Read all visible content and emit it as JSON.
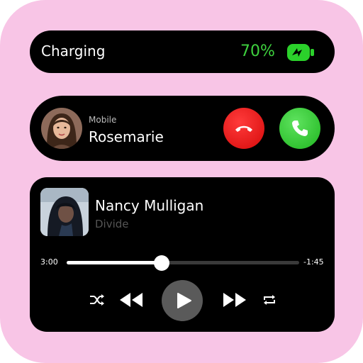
{
  "charging": {
    "label": "Charging",
    "percent": "70%",
    "level": 0.7,
    "icon": "battery-charging-icon",
    "accent": "#3ed13e"
  },
  "call": {
    "type_label": "Mobile",
    "caller_name": "Rosemarie",
    "decline_icon": "phone-hangup-icon",
    "accept_icon": "phone-icon",
    "decline_color": "#e01515",
    "accept_color": "#2ec12e"
  },
  "player": {
    "title": "Nancy Mulligan",
    "artist": "Divide",
    "elapsed": "3:00",
    "remaining": "-1:45",
    "progress": 0.41,
    "controls": [
      "shuffle-icon",
      "previous-icon",
      "play-icon",
      "next-icon",
      "repeat-icon"
    ]
  }
}
